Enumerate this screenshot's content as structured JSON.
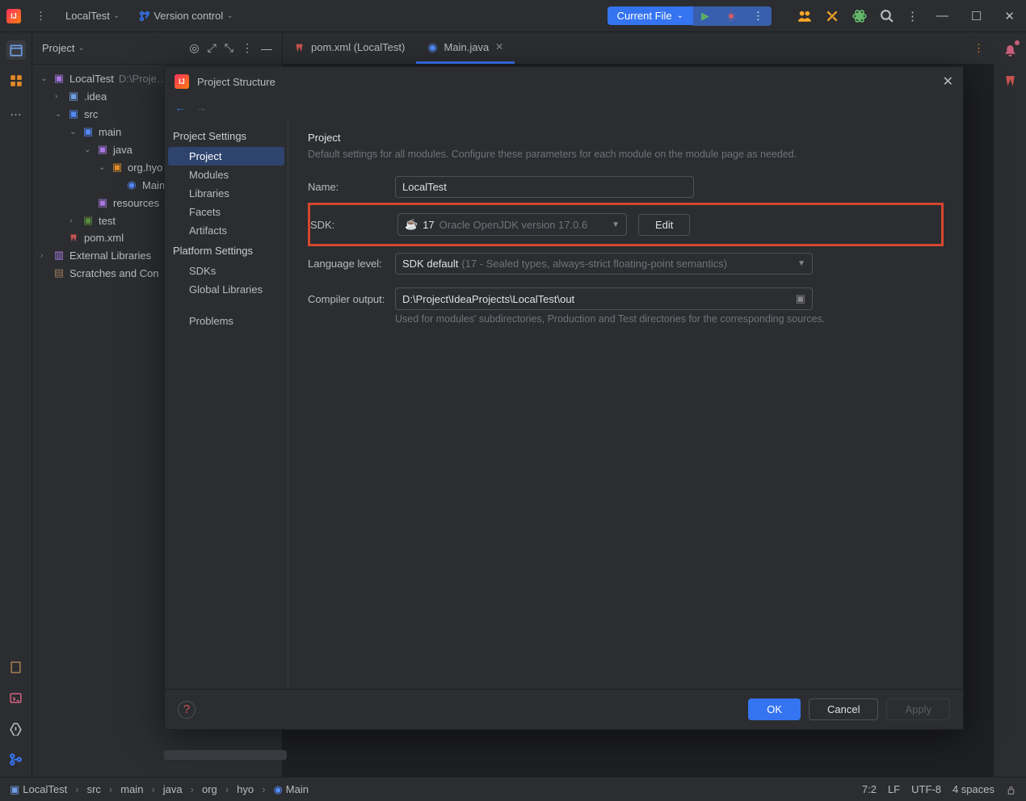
{
  "topbar": {
    "project_name": "LocalTest",
    "vcs_label": "Version control",
    "run_config": "Current File"
  },
  "project_panel": {
    "title": "Project",
    "tree": {
      "root_name": "LocalTest",
      "root_path": "D:\\Proje…",
      "idea": ".idea",
      "src": "src",
      "main": "main",
      "java": "java",
      "package": "org.hyo",
      "main_class": "Main",
      "resources": "resources",
      "test": "test",
      "pom": "pom.xml",
      "ext_libs": "External Libraries",
      "scratches": "Scratches and Con"
    }
  },
  "tabs": [
    {
      "label": "pom.xml (LocalTest)"
    },
    {
      "label": "Main.java"
    }
  ],
  "dialog": {
    "title": "Project Structure",
    "sidebar": {
      "project_settings": "Project Settings",
      "project": "Project",
      "modules": "Modules",
      "libraries": "Libraries",
      "facets": "Facets",
      "artifacts": "Artifacts",
      "platform_settings": "Platform Settings",
      "sdks": "SDKs",
      "global_libraries": "Global Libraries",
      "problems": "Problems"
    },
    "content": {
      "heading": "Project",
      "subheading": "Default settings for all modules. Configure these parameters for each module on the module page as needed.",
      "name_label": "Name:",
      "name_value": "LocalTest",
      "sdk_label": "SDK:",
      "sdk_version": "17",
      "sdk_desc": "Oracle OpenJDK version 17.0.6",
      "edit_button": "Edit",
      "lang_label": "Language level:",
      "lang_primary": "SDK default",
      "lang_secondary": "(17 - Sealed types, always-strict floating-point semantics)",
      "output_label": "Compiler output:",
      "output_path": "D:\\Project\\IdeaProjects\\LocalTest\\out",
      "output_hint": "Used for modules' subdirectories, Production and Test directories for the corresponding sources."
    },
    "footer": {
      "ok": "OK",
      "cancel": "Cancel",
      "apply": "Apply"
    }
  },
  "status": {
    "bc": [
      "LocalTest",
      "src",
      "main",
      "java",
      "org",
      "hyo",
      "Main"
    ],
    "pos": "7:2",
    "line_sep": "LF",
    "encoding": "UTF-8",
    "indent": "4 spaces"
  }
}
